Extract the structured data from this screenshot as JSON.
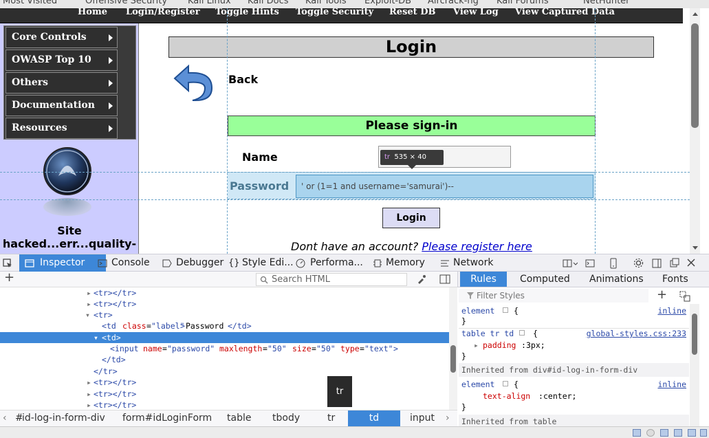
{
  "bookmarks": [
    "Most Visited",
    "Offensive Security",
    "Kali Linux",
    "Kali Docs",
    "Kali Tools",
    "Exploit-DB",
    "Aircrack-ng",
    "Kali Forums",
    "NetHunter"
  ],
  "topnav": [
    "Home",
    "Login/Register",
    "Toggle Hints",
    "Toggle Security",
    "Reset DB",
    "View Log",
    "View Captured Data"
  ],
  "sidebar": {
    "items": [
      {
        "label": "Core Controls"
      },
      {
        "label": "OWASP Top 10"
      },
      {
        "label": "Others"
      },
      {
        "label": "Documentation"
      },
      {
        "label": "Resources"
      }
    ],
    "site_text_1": "Site",
    "site_text_2": "hacked...err...quality-"
  },
  "main": {
    "title": "Login",
    "back_label": "Back",
    "signin_banner": "Please sign-in",
    "name_label": "Name",
    "password_label": "Password",
    "password_value": "' or (1=1 and username='samurai')--",
    "login_button": "Login",
    "register_prompt": "Dont have an account?",
    "register_link": "Please register here"
  },
  "highlighter_tip": {
    "tag": "tr",
    "size": "535 × 40"
  },
  "devtools": {
    "tabs": [
      "Inspector",
      "Console",
      "Debugger",
      "Style Edi...",
      "Performa...",
      "Memory",
      "Network"
    ],
    "search_placeholder": "Search HTML",
    "markup": {
      "collapsed_tr_1": "<tr></tr>",
      "collapsed_tr_2": "<tr></tr>",
      "open_tr": "<tr>",
      "td_open": "<td",
      "td_class_attr": "class",
      "td_class_val": "\"label\"",
      "td_text": "Password",
      "td_close": "</td>",
      "selected_td": "<td>",
      "input_open": "<input",
      "attr_name": "name",
      "attr_name_val": "\"password\"",
      "attr_maxlength": "maxlength",
      "attr_maxlength_val": "\"50\"",
      "attr_size": "size",
      "attr_size_val": "\"50\"",
      "attr_type": "type",
      "attr_type_val": "\"text\"",
      "input_close": ">",
      "td_end": "</td>",
      "tr_end": "</tr>",
      "collapsed_tr_3": "<tr></tr>",
      "collapsed_tr_4": "<tr></tr>",
      "collapsed_tr_5": "<tr></tr>"
    },
    "breadcrumbs": [
      "id-log-in-form-div",
      "form#idLoginForm",
      "table",
      "tbody",
      "tr",
      "td",
      "input"
    ],
    "hover_tooltip": "tr",
    "rules_tabs": [
      "Rules",
      "Computed",
      "Animations",
      "Fonts"
    ],
    "filter_placeholder": "Filter Styles",
    "rules": {
      "r1_selector": "element",
      "r1_open": "{",
      "r1_source": "inline",
      "r1_close": "}",
      "r2_selector": "table tr td",
      "r2_open": "{",
      "r2_source": "global-styles.css:233",
      "r2_prop": "padding",
      "r2_val": "3px;",
      "r2_close": "}",
      "inherit_1": "Inherited from div#id-log-in-form-div",
      "r3_selector": "element",
      "r3_open": "{",
      "r3_source": "inline",
      "r3_prop": "text-align",
      "r3_val": "center;",
      "r3_close": "}",
      "inherit_2": "Inherited from table"
    }
  }
}
